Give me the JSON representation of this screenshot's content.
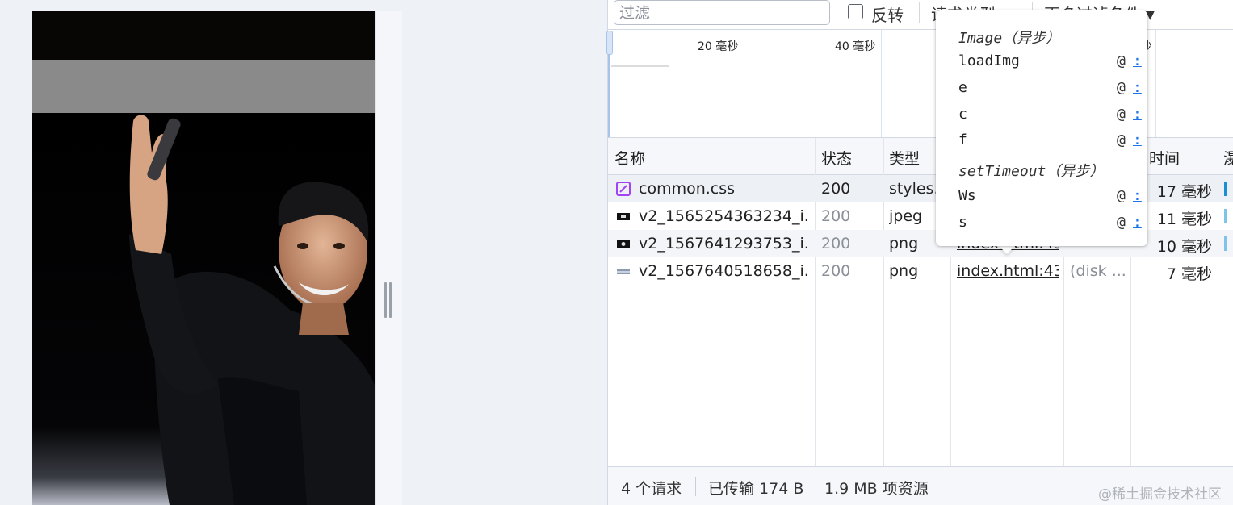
{
  "filter": {
    "placeholder": "过滤",
    "invert_label": "反转",
    "request_types": "请求类型",
    "more_filters": "更多过滤条件"
  },
  "overview": {
    "ticks": [
      "20 毫秒",
      "40 毫秒",
      "秒"
    ]
  },
  "table": {
    "columns": [
      "名称",
      "状态",
      "类型",
      "时间",
      "瀑"
    ],
    "rows": [
      {
        "name": "common.css",
        "status": "200",
        "type": "styles...",
        "initiator": "",
        "size": "",
        "time": "17 毫秒",
        "icon": "stylesheet-icon"
      },
      {
        "name": "v2_1565254363234_i...",
        "status": "200",
        "type": "jpeg",
        "initiator": "",
        "size": "",
        "time": "11 毫秒",
        "icon": "image-thumbnail-icon"
      },
      {
        "name": "v2_1567641293753_i...",
        "status": "200",
        "type": "png",
        "initiator": "index.html:43",
        "size": "",
        "time": "10 毫秒",
        "icon": "image-thumbnail-icon"
      },
      {
        "name": "v2_1567640518658_i...",
        "status": "200",
        "type": "png",
        "initiator": "index.html:43",
        "size": "(disk ...",
        "time": "7 毫秒",
        "icon": "image-thumbnail-icon"
      }
    ]
  },
  "footer": {
    "requests": "4 个请求",
    "transferred": "已传输 174 B",
    "resources": "1.9 MB 项资源"
  },
  "initiator_popover": {
    "frames": [
      {
        "text": "Image（异步）",
        "async": true
      },
      {
        "text": "loadImg",
        "at": "@",
        "link": ":"
      },
      {
        "text": "e",
        "at": "@",
        "link": ":"
      },
      {
        "text": "c",
        "at": "@",
        "link": ":"
      },
      {
        "text": "f",
        "at": "@",
        "link": ":"
      },
      {
        "text": "setTimeout（异步）",
        "async": true
      },
      {
        "text": "Ws",
        "at": "@",
        "link": ":"
      },
      {
        "text": "s",
        "at": "@",
        "link": ":"
      }
    ]
  },
  "watermark": "@稀土掘金技术社区",
  "colors": {
    "accent": "#1a73e8",
    "waterfall": "#1a8fd6",
    "css_icon": "#a142f4"
  }
}
